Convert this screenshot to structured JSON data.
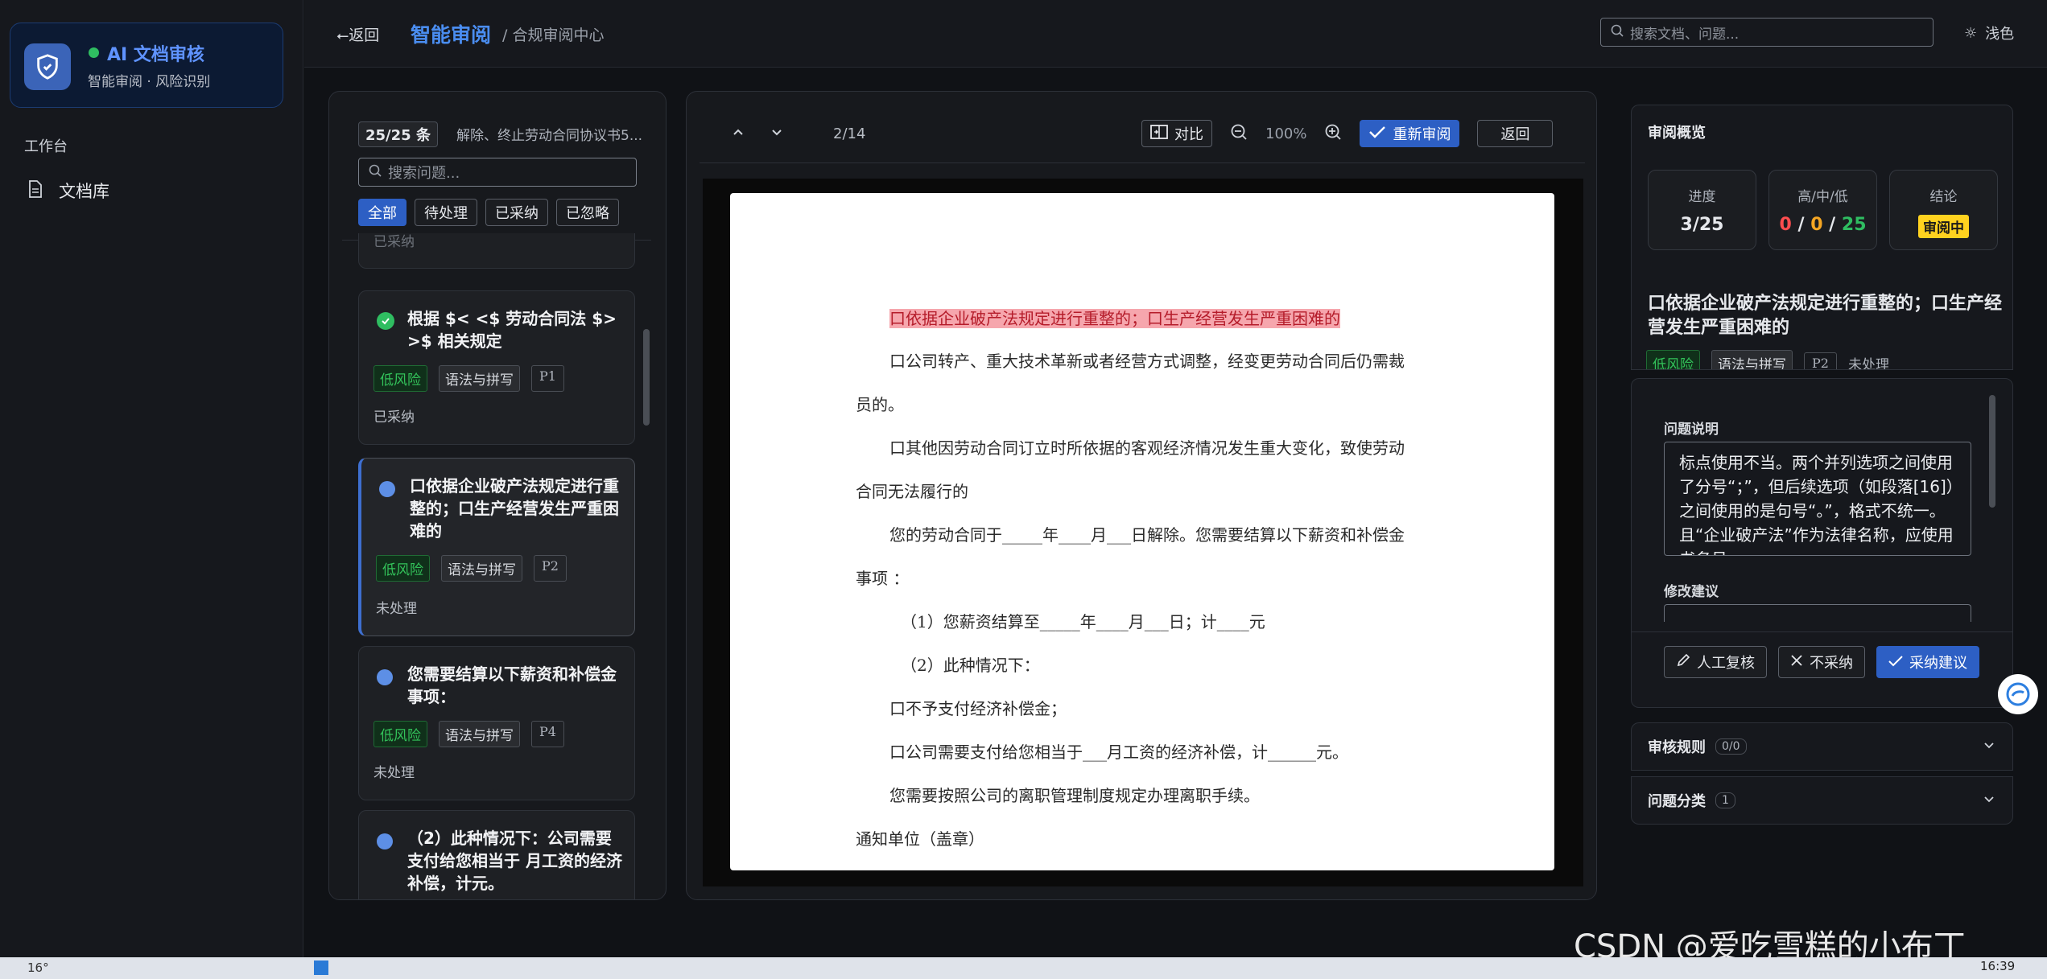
{
  "sidebar": {
    "brand_title": "AI 文档审核",
    "brand_subtitle": "智能审阅 · 风险识别",
    "section_label": "工作台",
    "nav_doclib": "文档库"
  },
  "topbar": {
    "back": "⭠返回",
    "app_name": "智能审阅",
    "breadcrumb": "/ 合规审阅中心",
    "search_placeholder": "搜索文档、问题...",
    "theme": "浅色"
  },
  "list": {
    "count": "25/25 条",
    "doc_title": "解除、终止劳动合同协议书5...",
    "search_placeholder": "搜索问题...",
    "filters": [
      "全部",
      "待处理",
      "已采纳",
      "已忽略"
    ],
    "partial_top": "已采纳",
    "cards": [
      {
        "title": "根据 $< <$ 劳动合同法 $> >$ 相关规定",
        "risk": "低风险",
        "category": "语法与拼写",
        "page": "P1",
        "status": "已采纳"
      },
      {
        "title": "口依据企业破产法规定进行重整的；口生产经营发生严重困难的",
        "risk": "低风险",
        "category": "语法与拼写",
        "page": "P2",
        "status": "未处理"
      },
      {
        "title": "您需要结算以下薪资和补偿金事项：",
        "risk": "低风险",
        "category": "语法与拼写",
        "page": "P4",
        "status": "未处理"
      },
      {
        "title": "（2）此种情况下：公司需要支付给您相当于 月工资的经济补偿，计元。",
        "risk": "",
        "category": "",
        "page": "",
        "status": ""
      }
    ]
  },
  "doc": {
    "page_indicator": "2/14",
    "compare": "对比",
    "zoom": "100%",
    "rereview": "重新审阅",
    "back": "返回",
    "lines": [
      "口依据企业破产法规定进行重整的；口生产经营发生严重困难的",
      "口公司转产、重大技术革新或者经营方式调整，经变更劳动合同后仍需裁",
      "员的。",
      "口其他因劳动合同订立时所依据的客观经济情况发生重大变化，致使劳动",
      "合同无法履行的",
      "您的劳动合同于_____年____月___日解除。您需要结算以下薪资和补偿金",
      "事项 ：",
      "（1）您薪资结算至_____年____月___日；计____元",
      "（2）此种情况下：",
      "口不予支付经济补偿金；",
      "口公司需要支付给您相当于___月工资的经济补偿，计______元。",
      "您需要按照公司的离职管理制度规定办理离职手续。",
      "通知单位（盖章）"
    ]
  },
  "overview": {
    "title": "审阅概览",
    "progress_label": "进度",
    "progress_value": "3/25",
    "risk_label": "高/中/低",
    "risk_high": "0",
    "risk_mid": "0",
    "risk_low": "25",
    "sep": "/",
    "conclusion_label": "结论",
    "conclusion_value": "审阅中"
  },
  "issue": {
    "title": "口依据企业破产法规定进行重整的；口生产经营发生严重困难的",
    "risk": "低风险",
    "category": "语法与拼写",
    "page": "P2",
    "status": "未处理",
    "desc_label": "问题说明",
    "desc": "标点使用不当。两个并列选项之间使用了分号“；”，但后续选项（如段落[16]）之间使用的是句号“。”，格式不统一。且“企业破产法”作为法律名称，应使用书名号。",
    "suggest_label": "修改建议",
    "btn_manual": "人工复核",
    "btn_reject": "不采纳",
    "btn_accept": "采纳建议"
  },
  "accordions": {
    "rules_label": "审核规则",
    "rules_count": "0/0",
    "category_label": "问题分类",
    "category_count": "1"
  },
  "watermark": "CSDN @爱吃雪糕的小布丁",
  "taskbar": {
    "weather": "16°",
    "clock": "16:39"
  },
  "colors": {
    "accent": "#2d5fc4",
    "risk_low": "#2fbd61",
    "risk_high": "#ff4d4f",
    "risk_mid": "#f5a623",
    "highlight": "#f6a6ad"
  }
}
